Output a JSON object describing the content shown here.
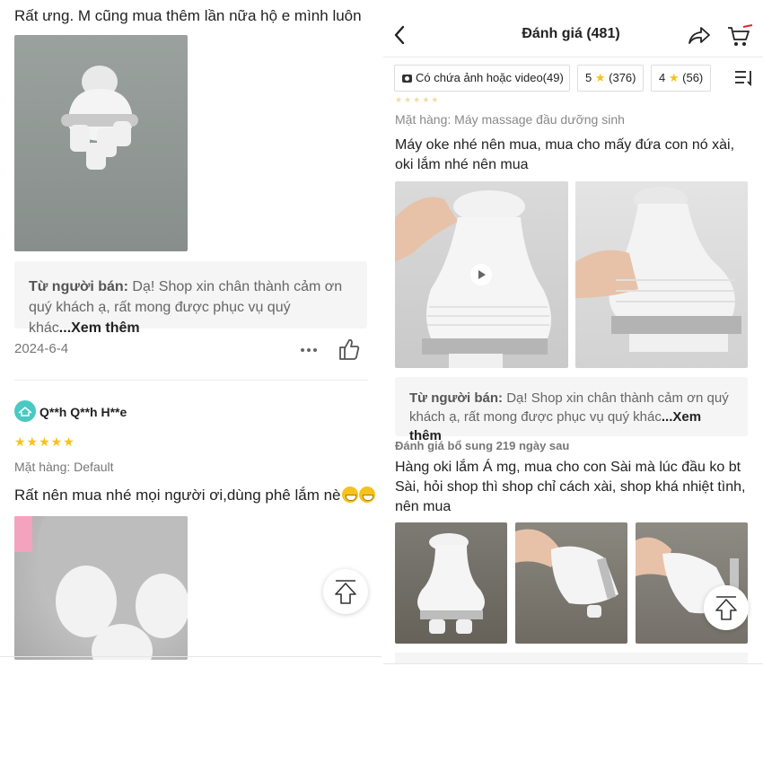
{
  "left": {
    "review1_text": "Rất ưng. M cũng mua thêm lần nữa hộ e mình luôn",
    "seller_reply": {
      "prefix": "Từ người bán:",
      "text": " Dạ! Shop xin chân thành cảm ơn quý khách ạ, rất mong được phục vụ quý khác",
      "more": "...Xem thêm"
    },
    "date": "2024-6-4",
    "review2": {
      "username": "Q**h Q**h H**e",
      "stars": "★★★★★",
      "variant": "Mặt hàng: Default",
      "comment": "Rất nên mua nhé mọi người ơi,dùng phê lắm nè"
    }
  },
  "right": {
    "header_title": "Đánh giá (481)",
    "filters": [
      {
        "label": "Có chứa ảnh hoặc video(49)"
      },
      {
        "label_num": "5",
        "star": "★",
        "count": "(376)"
      },
      {
        "label_num": "4",
        "star": "★",
        "count": "(56)"
      }
    ],
    "faint_stars": "★★★★★",
    "variant": "Mặt hàng: Máy massage đầu dưỡng sinh",
    "comment1": "Máy oke nhé nên mua, mua cho mấy đứa con nó xài, oki lắm nhé nên mua",
    "seller_reply": {
      "prefix": "Từ người bán:",
      "text": " Dạ! Shop xin chân thành cảm ơn quý khách ạ, rất mong được phục vụ quý khác",
      "more": "...Xem thêm"
    },
    "supplement_label": "Đánh giá bổ sung 219 ngày sau",
    "comment2": "Hàng oki lắm Á mg, mua cho con Sài mà lúc đầu ko bt Sài, hỏi shop thì shop chỉ cách xài, shop khá nhiệt tình, nên mua"
  },
  "colors": {
    "star": "#f6c21b",
    "avatar": "#49c9c2",
    "seller_bg": "#f5f5f5",
    "cart_accent": "#e8242b"
  },
  "icons": [
    "back-icon",
    "share-icon",
    "cart-icon",
    "sort-icon",
    "camera-icon",
    "play-icon",
    "more-dots-icon",
    "thumbs-up-icon",
    "scroll-top-icon"
  ]
}
